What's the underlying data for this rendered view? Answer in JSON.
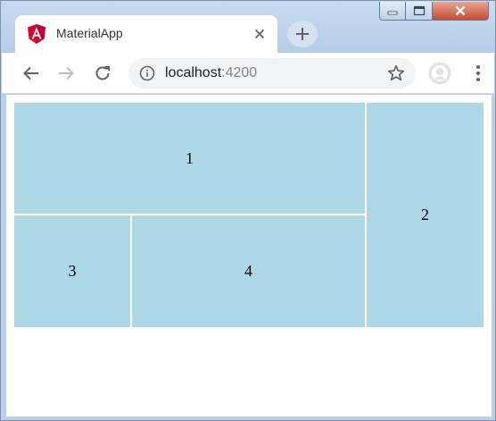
{
  "tab": {
    "title": "MaterialApp",
    "favicon": "angular-icon",
    "accent_color": "#dd0031"
  },
  "omnibox": {
    "host": "localhost",
    "port": ":4200"
  },
  "grid": {
    "tile_color": "#add8e6",
    "tiles": [
      {
        "label": "1"
      },
      {
        "label": "2"
      },
      {
        "label": "3"
      },
      {
        "label": "4"
      }
    ]
  }
}
